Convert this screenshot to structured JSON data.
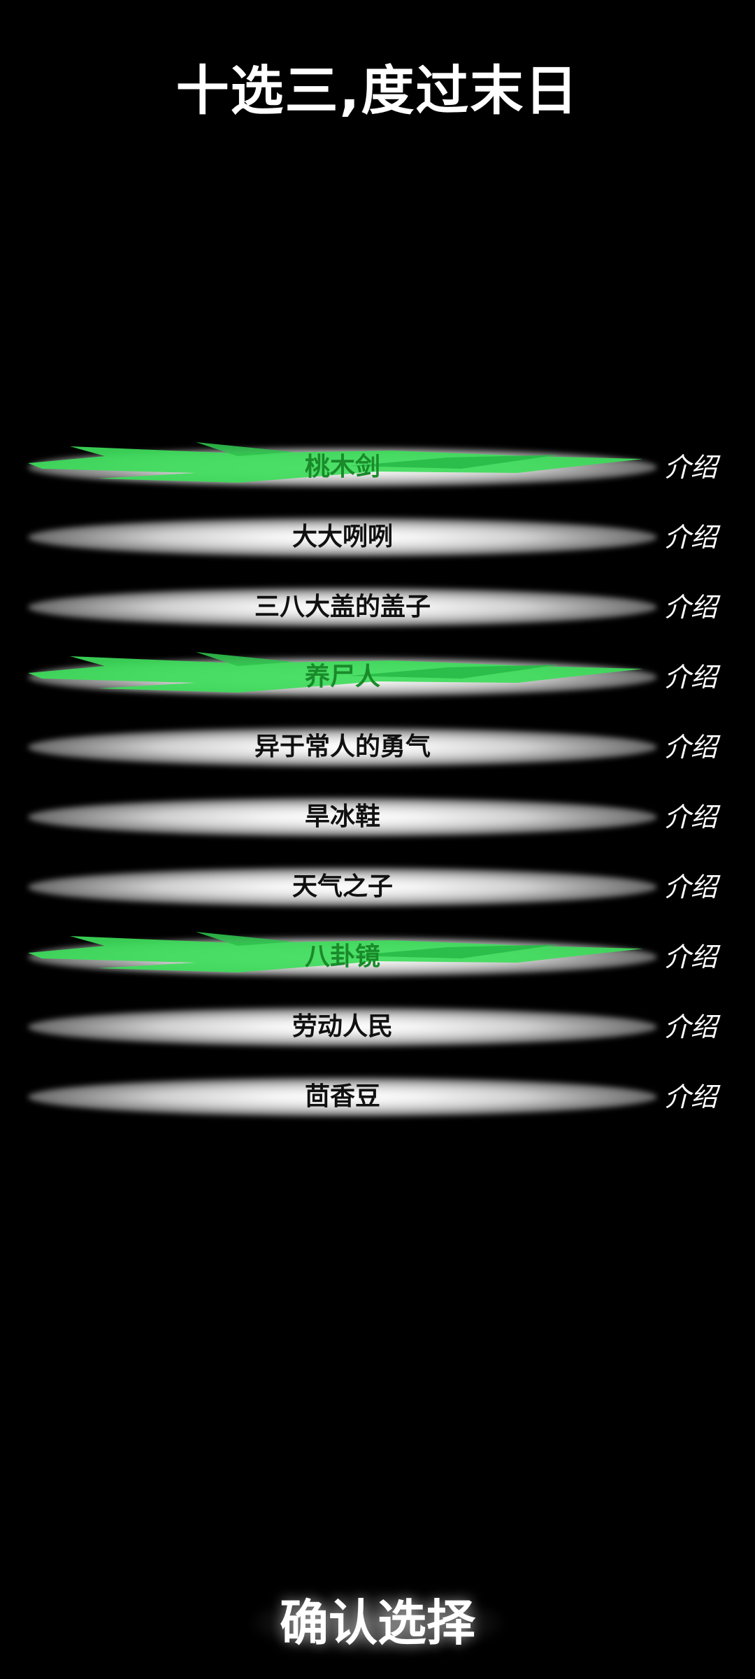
{
  "title": "十选三,度过末日",
  "colors": {
    "background": "#000000",
    "selected_accent": "#3ddc5a",
    "selected_text": "#1a8a2a",
    "item_text": "#111111",
    "intro_text": "#ffffff"
  },
  "items": [
    {
      "label": "桃木剑",
      "intro": "介绍",
      "selected": true
    },
    {
      "label": "大大咧咧",
      "intro": "介绍",
      "selected": false
    },
    {
      "label": "三八大盖的盖子",
      "intro": "介绍",
      "selected": false
    },
    {
      "label": "养尸人",
      "intro": "介绍",
      "selected": true
    },
    {
      "label": "异于常人的勇气",
      "intro": "介绍",
      "selected": false
    },
    {
      "label": "旱冰鞋",
      "intro": "介绍",
      "selected": false
    },
    {
      "label": "天气之子",
      "intro": "介绍",
      "selected": false
    },
    {
      "label": "八卦镜",
      "intro": "介绍",
      "selected": true
    },
    {
      "label": "劳动人民",
      "intro": "介绍",
      "selected": false
    },
    {
      "label": "茴香豆",
      "intro": "介绍",
      "selected": false
    }
  ],
  "confirm_label": "确认选择"
}
